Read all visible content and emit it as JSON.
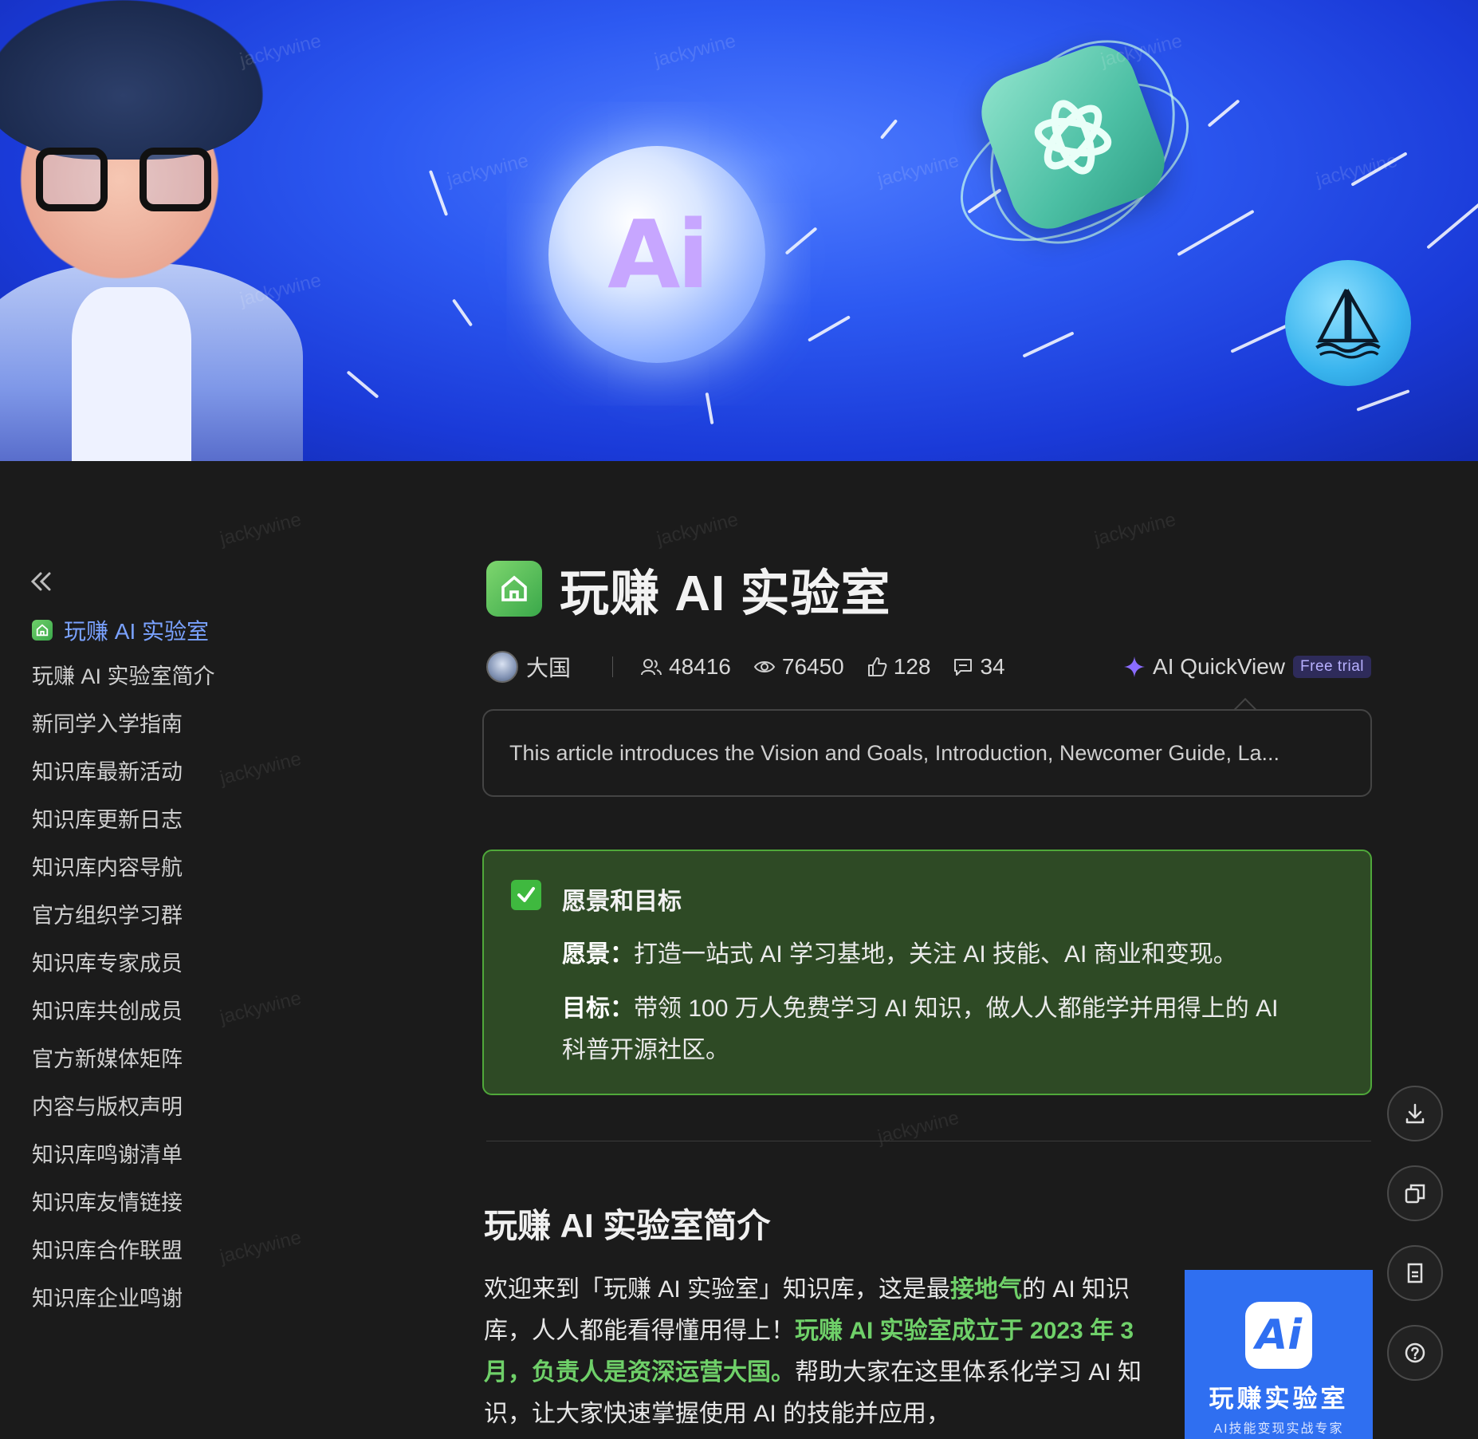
{
  "banner": {
    "ai_bubble_text": "Ai",
    "watermark": "jackywine"
  },
  "sidebar": {
    "collapse_icon": "double-chevron-left-icon",
    "title": "玩赚 AI 实验室",
    "items": [
      "玩赚 AI 实验室简介",
      "新同学入学指南",
      "知识库最新活动",
      "知识库更新日志",
      "知识库内容导航",
      "官方组织学习群",
      "知识库专家成员",
      "知识库共创成员",
      "官方新媒体矩阵",
      "内容与版权声明",
      "知识库鸣谢清单",
      "知识库友情链接",
      "知识库合作联盟",
      "知识库企业鸣谢"
    ]
  },
  "page": {
    "title": "玩赚 AI 实验室",
    "author": "大国",
    "stats": {
      "members": "48416",
      "views": "76450",
      "likes": "128",
      "comments": "34"
    },
    "quickview_label": "AI QuickView",
    "quickview_badge": "Free trial",
    "summary": "This article introduces the Vision and Goals, Introduction, Newcomer Guide, La..."
  },
  "callout": {
    "title": "愿景和目标",
    "vision_label": "愿景：",
    "vision_text": "打造一站式 AI 学习基地，关注 AI 技能、AI 商业和变现。",
    "goal_label": "目标：",
    "goal_text_1": "带领 100 万人免费学习 AI 知识，做人人都能学并用得上的 AI",
    "goal_text_2": "科普开源社区。"
  },
  "section": {
    "title": "玩赚 AI 实验室简介",
    "p1": "欢迎来到「玩赚 AI 实验室」知识库，这是最",
    "p1_hl": "接地气",
    "p2": "的 AI 知识库，人人都能看得懂用得上！",
    "p2_hl": "玩赚 AI 实验室成立于 2023 年 3 月，负责人是资深运营大国。",
    "p3": "帮助大家在这里体系化学习 AI 知识，让大家快速掌握使用 AI 的技能并应用，"
  },
  "promo": {
    "logo_text": "Ai",
    "name": "玩赚实验室",
    "tagline": "AI技能变现实战专家"
  },
  "float_buttons": [
    "download-icon",
    "copy-icon",
    "document-icon",
    "help-icon"
  ]
}
